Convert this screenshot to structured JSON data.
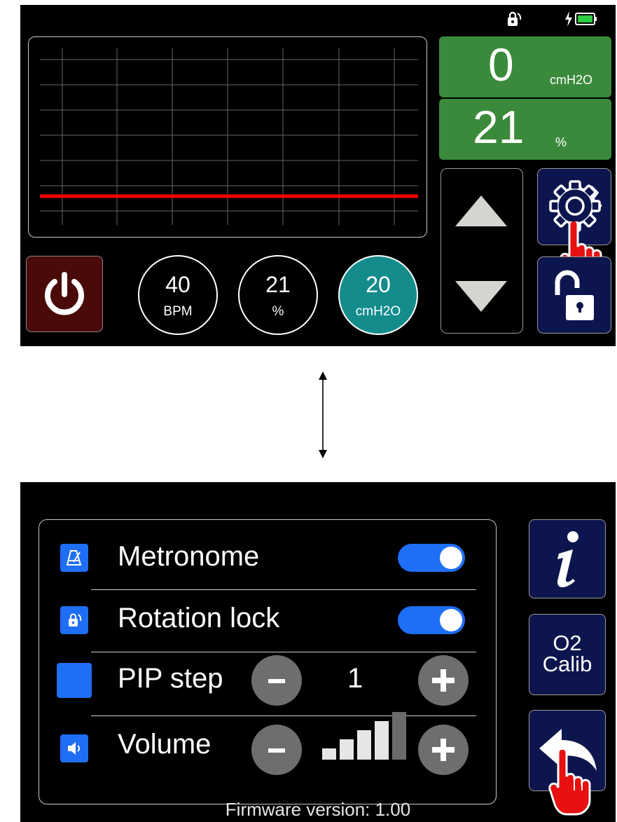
{
  "main_screen": {
    "pressure": {
      "value": "0",
      "unit": "cmH2O"
    },
    "oxygen": {
      "value": "21",
      "unit": "%"
    },
    "settings": [
      {
        "value": "40",
        "unit": "BPM",
        "selected": false
      },
      {
        "value": "21",
        "unit": "%",
        "selected": false
      },
      {
        "value": "20",
        "unit": "cmH2O",
        "selected": true
      }
    ],
    "status_icons": [
      "rotation-lock-icon",
      "charging-icon",
      "battery-icon"
    ],
    "colors": {
      "readout": "#3b8a3b",
      "selected_setting": "#148c8c",
      "trace": "#ff0000",
      "button": "#0c154d",
      "power": "#4a0a0a"
    }
  },
  "settings_screen": {
    "rows": [
      {
        "label": "Metronome",
        "icon": "metronome-icon",
        "toggle_on": true
      },
      {
        "label": "Rotation lock",
        "icon": "rotation-lock-icon",
        "toggle_on": true
      },
      {
        "label": "PIP step",
        "icon": "blank-icon",
        "value": "1"
      },
      {
        "label": "Volume",
        "icon": "speaker-icon",
        "level": 4,
        "level_max": 5
      }
    ],
    "side_buttons": {
      "info_label": "i",
      "calib_line1": "O2",
      "calib_line2": "Calib"
    },
    "firmware": "Firmware version: 1.00",
    "colors": {
      "toggle": "#1e6ff5",
      "round_button": "#6e6e6e",
      "button": "#0c154d"
    }
  }
}
